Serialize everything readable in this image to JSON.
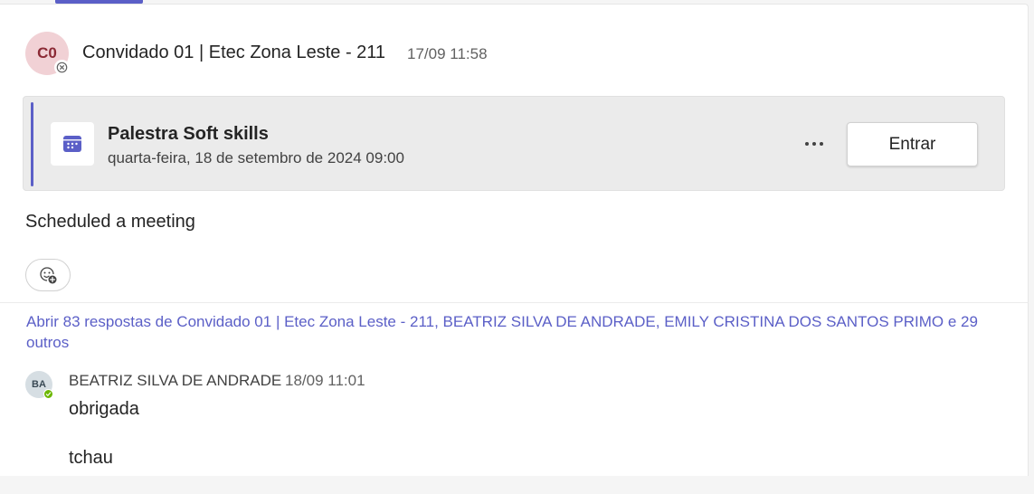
{
  "post": {
    "avatar_initials": "C0",
    "author": "Convidado 01 | Etec Zona Leste - 211",
    "timestamp": "17/09 11:58",
    "presence": "offline",
    "body": "Scheduled a meeting"
  },
  "meeting": {
    "icon": "calendar-icon",
    "title": "Palestra Soft skills",
    "datetime": "quarta-feira, 18 de setembro de 2024 09:00",
    "more_label": "···",
    "join_label": "Entrar"
  },
  "reaction": {
    "icon": "add-reaction-icon"
  },
  "replies": {
    "link_text": "Abrir 83 respostas de Convidado 01 | Etec Zona Leste - 211, BEATRIZ SILVA DE ANDRADE, EMILY CRISTINA DOS SANTOS PRIMO e 29 outros"
  },
  "reply": {
    "avatar_initials": "BA",
    "author": "BEATRIZ SILVA DE ANDRADE",
    "timestamp": "18/09 11:01",
    "presence": "available",
    "lines": [
      "obrigada",
      "tchau"
    ]
  },
  "colors": {
    "accent": "#5b5fc7",
    "avatar_bg": "#f1d1d5",
    "presence_available": "#6bb700"
  }
}
